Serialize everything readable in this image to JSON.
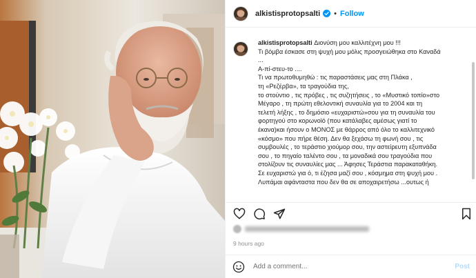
{
  "post": {
    "username": "alkistisprotopsalti",
    "separator": "•",
    "follow_label": "Follow",
    "caption_user": "alkistisprotopsalti",
    "caption_first_line": "Διονύση μου καλλιτέχνη μου !!!",
    "caption_lines": [
      "Τι βόμβα έσκασε στη ψυχή μου μόλις προσγειώθηκα στο Καναδά",
      "...",
      "Α-πί-στευ-το ....",
      "Τι να πρωτοθυμηθώ : τις παραστάσεις μας στη Πλάκα ,",
      " τη «Ρεζέρβα», τα τραγούδια της,",
      " το στούντιο , τις πρόβες , τις συζητήσεις , το «Μυστικό τοπίο»στο",
      "Μέγαρο , τη πρώτη εθελοντική συναυλία για το 2004 και τη",
      "τελετή λήξης , το δημόσιο «ευχαριστώ»σου για τη συναυλία του",
      "φορτηγού στο κορωνοϊό (που κατάλαβες αμέσως γιατί το",
      "έκανα)και ήσουν ο ΜΟΝΟΣ με θάρρος από όλο το καλλιτεχνικό",
      "«κόσμο» που πήρε θέση. Δεν θα ξεχάσω τη φωνή σου , τις",
      "συμβουλές , το τεράστιο χιούμορ σου, την αστείρευτη εξυπνάδα",
      "σου , το πηγαίο ταλέντο σου , τα μοναδικά σου τραγούδια που",
      "στολίζουν τις συναυλίες μας ... Άφησες Τεράστια παρακαταθήκη.",
      "Σε ευχαριστώ για ό, τι έζησα μαζί σου , κόσμημα στη ψυχή μου .",
      "Λυπάμαι αφάνταστα που δεν θα σε αποχαιρετήσω ...ουτως ή"
    ],
    "timestamp": "9 hours ago",
    "comment_placeholder": "Add a comment...",
    "post_label": "Post"
  },
  "icons": {
    "verified": "verified-badge-icon",
    "like": "heart-icon",
    "comment": "comment-bubble-icon",
    "share": "send-paper-plane-icon",
    "save": "bookmark-icon",
    "emoji": "smiley-emoji-icon"
  },
  "colors": {
    "accent": "#0095f6",
    "verified": "#0095f6",
    "muted_text": "#8e8e8e",
    "post_disabled": "#b3dbff"
  }
}
